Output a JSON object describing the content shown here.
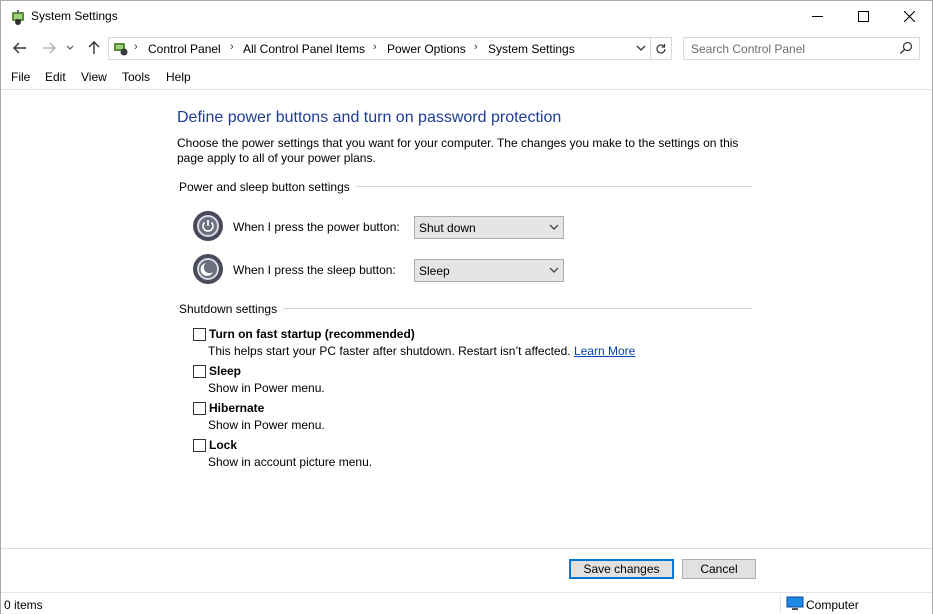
{
  "window": {
    "title": "System Settings",
    "icon": "power-options-icon"
  },
  "titlebar_buttons": {
    "minimize": "minimize-icon",
    "maximize": "maximize-icon",
    "close": "close-icon"
  },
  "breadcrumb": [
    "Control Panel",
    "All Control Panel Items",
    "Power Options",
    "System Settings"
  ],
  "search": {
    "placeholder": "Search Control Panel"
  },
  "menu": [
    "File",
    "Edit",
    "View",
    "Tools",
    "Help"
  ],
  "content": {
    "heading": "Define power buttons and turn on password protection",
    "description": "Choose the power settings that you want for your computer. The changes you make to the settings on this page apply to all of your power plans.",
    "power_group": {
      "title": "Power and sleep button settings",
      "power_button": {
        "label": "When I press the power button:",
        "value": "Shut down"
      },
      "sleep_button": {
        "label": "When I press the sleep button:",
        "value": "Sleep"
      }
    },
    "shutdown_group": {
      "title": "Shutdown settings",
      "items": [
        {
          "label": "Turn on fast startup (recommended)",
          "sub": "This helps start your PC faster after shutdown. Restart isn’t affected.",
          "link": "Learn More",
          "checked": false
        },
        {
          "label": "Sleep",
          "sub": "Show in Power menu.",
          "checked": false
        },
        {
          "label": "Hibernate",
          "sub": "Show in Power menu.",
          "checked": false
        },
        {
          "label": "Lock",
          "sub": "Show in account picture menu.",
          "checked": false
        }
      ]
    }
  },
  "buttons": {
    "save": "Save changes",
    "cancel": "Cancel"
  },
  "status": {
    "items": "0 items",
    "location": "Computer"
  },
  "colors": {
    "heading": "#1f3c93",
    "link": "#0645ad",
    "accent": "#0078d7"
  }
}
